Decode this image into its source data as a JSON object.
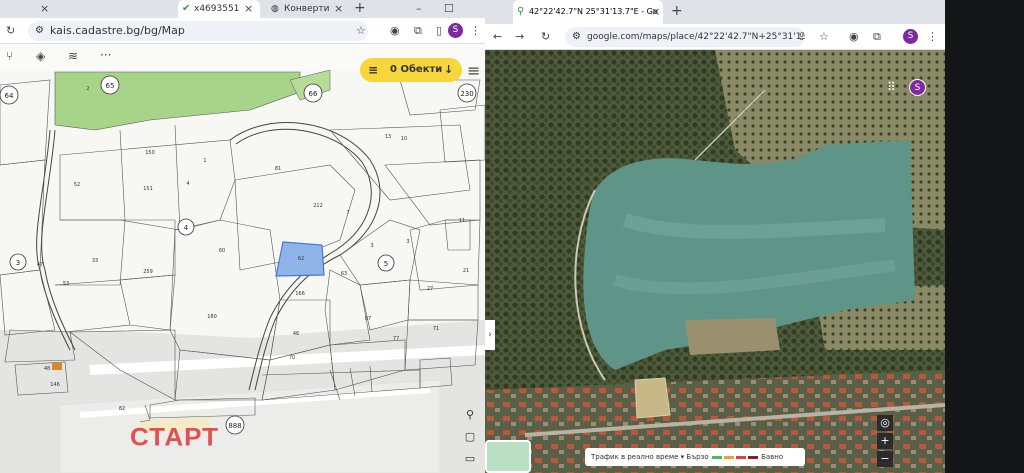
{
  "left_window": {
    "tabs": [
      {
        "label": ""
      },
      {
        "label": "x4693551"
      },
      {
        "label": "Конверти"
      }
    ],
    "url": "kais.cadastre.bg/bg/Map",
    "profile_initial": "S",
    "objects_button_label": "0 Обекти",
    "start_label": "СТАРТ",
    "map_labels": {
      "circles": [
        "64",
        "65",
        "66",
        "230",
        "4",
        "5",
        "3",
        "888"
      ],
      "parcels": [
        "2",
        "52",
        "150",
        "151",
        "1",
        "81",
        "33",
        "4",
        "60",
        "62",
        "259",
        "53",
        "7",
        "3",
        "27",
        "166",
        "63",
        "21",
        "180",
        "46",
        "67",
        "71",
        "77",
        "70",
        "48",
        "146",
        "47",
        "11",
        "13",
        "212",
        "10",
        "3",
        "82"
      ]
    }
  },
  "right_window": {
    "tab_title": "42°22'42.7\"N 25°31'13.7\"E - Go",
    "url": "google.com/maps/place/42°22'42.7\"N+25°31'13.7\"E...",
    "profile_initial": "S",
    "traffic_label": "Трафик в реално време",
    "traffic_fast": "Бързо",
    "traffic_slow": "Бавно",
    "colors": {
      "avatar": "#7b2aa0",
      "highlight_parcel": "#8fb4ea",
      "forest": "#a8d48a"
    }
  }
}
